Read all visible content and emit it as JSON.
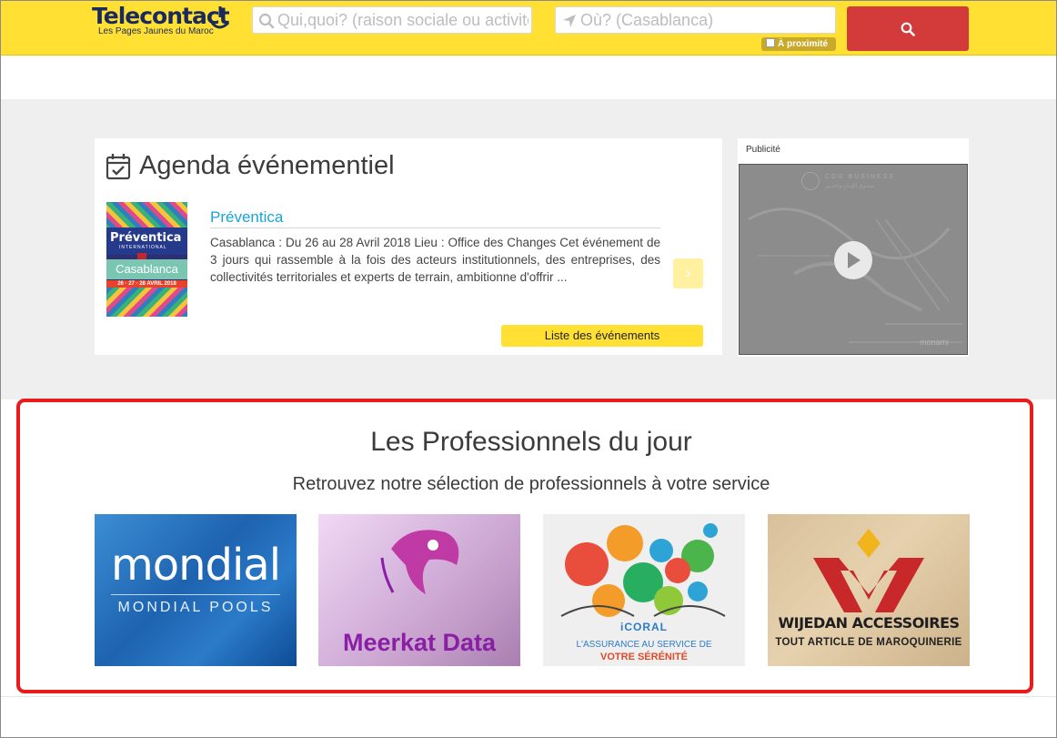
{
  "header": {
    "logo_text": "Telecontact",
    "logo_tagline": "Les Pages Jaunes du Maroc",
    "what_placeholder": "Qui,quoi? (raison sociale ou activité)",
    "where_placeholder": "Où? (Casablanca)",
    "proximity_label": "À proximité",
    "icons": {
      "what": "search-icon",
      "where": "location-arrow-icon",
      "submit": "search-icon"
    },
    "colors": {
      "bar": "#ffe033",
      "submit": "#d33a3a"
    }
  },
  "agenda": {
    "title": "Agenda événementiel",
    "icon": "calendar-check-icon",
    "event": {
      "title": "Préventica",
      "description": "Casablanca : Du 26 au 28 Avril 2018 Lieu : Office des Changes Cet événement de 3 jours qui rassemble à la fois des acteurs institutionnels, des entreprises, des collectivités territoriales et experts de terrain, ambitionne d'offrir ...",
      "poster": {
        "name": "Préventica",
        "intl": "INTERNATIONAL",
        "city": "Casablanca",
        "dates": "26 · 27 · 28 AVRIL 2018"
      }
    },
    "next_icon": "chevron-right-icon",
    "list_button": "Liste des événements"
  },
  "ad": {
    "label": "Publicité",
    "video_logo": "CDG BUSINESS",
    "video_logo_sub": "صندوق الإيداع والتدبير",
    "video_brand": "monami",
    "play_icon": "play-icon"
  },
  "pros": {
    "title": "Les Professionnels du jour",
    "subtitle": "Retrouvez notre sélection de professionnels à votre service",
    "cards": [
      {
        "logo": "mondial",
        "name": "MONDIAL POOLS"
      },
      {
        "name": "Meerkat Data"
      },
      {
        "logo": "iCORAL",
        "tag1": "L'ASSURANCE AU SERVICE DE",
        "tag2": "VOTRE SÉRÉNITÉ"
      },
      {
        "name": "WIJEDAN ACCESSOIRES",
        "sub": "TOUT ARTICLE DE MAROQUINERIE"
      }
    ],
    "highlight_color": "#ea1b1b"
  }
}
